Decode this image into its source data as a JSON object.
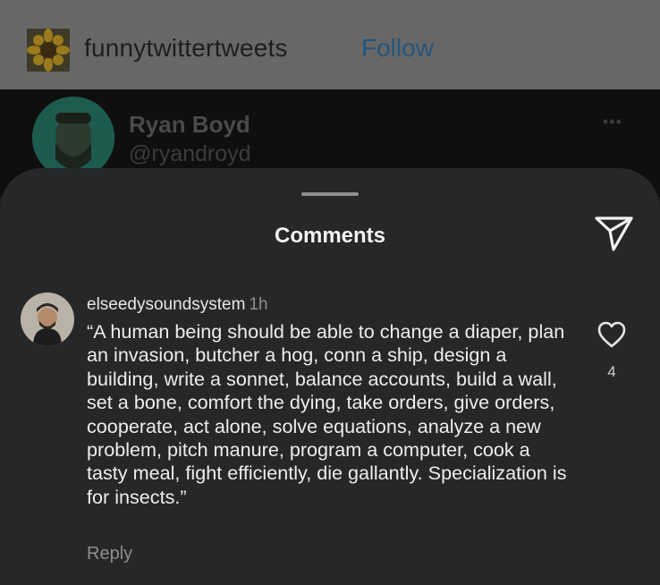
{
  "post": {
    "account": "funnytwittertweets",
    "follow_label": "Follow",
    "tweet": {
      "name": "Ryan Boyd",
      "handle": "@ryandroyd",
      "more_icon": "more-dots-icon"
    }
  },
  "comments_sheet": {
    "title": "Comments",
    "share_icon": "send-icon",
    "comment": {
      "username": "elseedysoundsystem",
      "time": "1h",
      "text": "“A human being should be able to change a diaper, plan an invasion, butcher a hog, conn a ship, design a building, write a sonnet, balance accounts, build a wall, set a bone, comfort the dying, take orders, give orders, cooperate, act alone, solve equations, analyze a new problem, pitch manure, program a computer, cook a tasty meal, fight efficiently, die gallantly. Specialization is for insects.”",
      "reply_label": "Reply",
      "like_icon": "heart-icon",
      "like_count": "4"
    }
  },
  "colors": {
    "sheet_background": "#262729",
    "header_background": "#676767",
    "follow_blue": "#24557d",
    "muted_text": "#8e8e8e"
  }
}
